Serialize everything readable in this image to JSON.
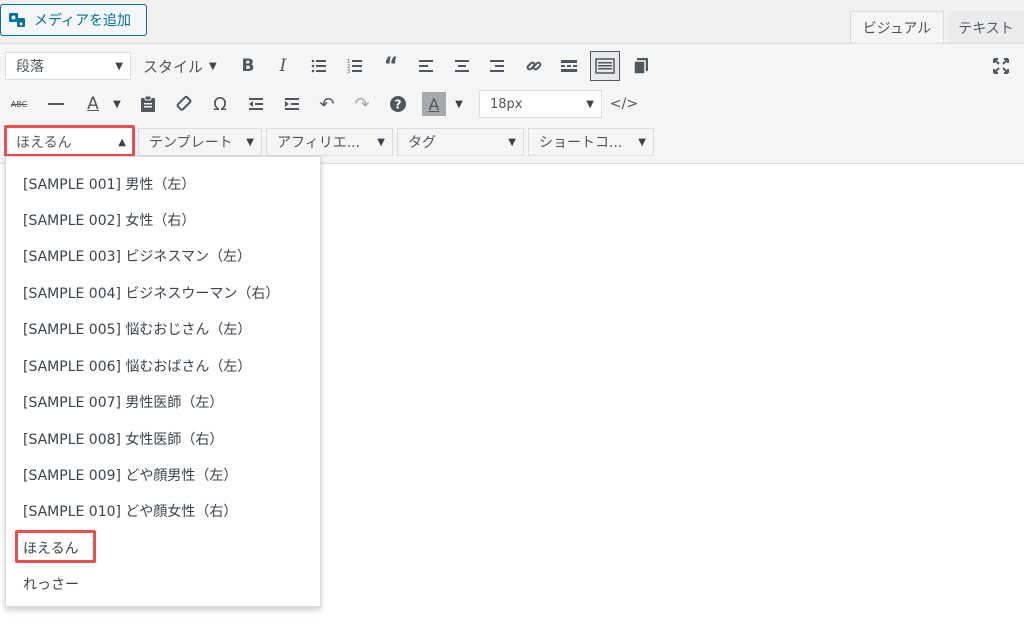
{
  "header": {
    "add_media_label": "メディアを追加",
    "tab_visual": "ビジュアル",
    "tab_text": "テキスト"
  },
  "toolbar1": {
    "format_select": "段落",
    "style_menu": "スタイル"
  },
  "toolbar2": {
    "font_size": "18px"
  },
  "toolbar3": {
    "speech_bubble": "ほえるん",
    "template": "テンプレート",
    "affiliate": "アフィリエ...",
    "tag": "タグ",
    "shortcode": "ショートコ..."
  },
  "dropdown": {
    "items": [
      "[SAMPLE 001] 男性（左）",
      "[SAMPLE 002] 女性（右）",
      "[SAMPLE 003] ビジネスマン（左）",
      "[SAMPLE 004] ビジネスウーマン（右）",
      "[SAMPLE 005] 悩むおじさん（左）",
      "[SAMPLE 006] 悩むおばさん（左）",
      "[SAMPLE 007] 男性医師（左）",
      "[SAMPLE 008] 女性医師（右）",
      "[SAMPLE 009] どや顔男性（左）",
      "[SAMPLE 010] どや顔女性（右）",
      "ほえるん",
      "れっさー"
    ]
  },
  "colors": {
    "highlight": "#ef4c4c",
    "media_button": "#0071a1"
  }
}
